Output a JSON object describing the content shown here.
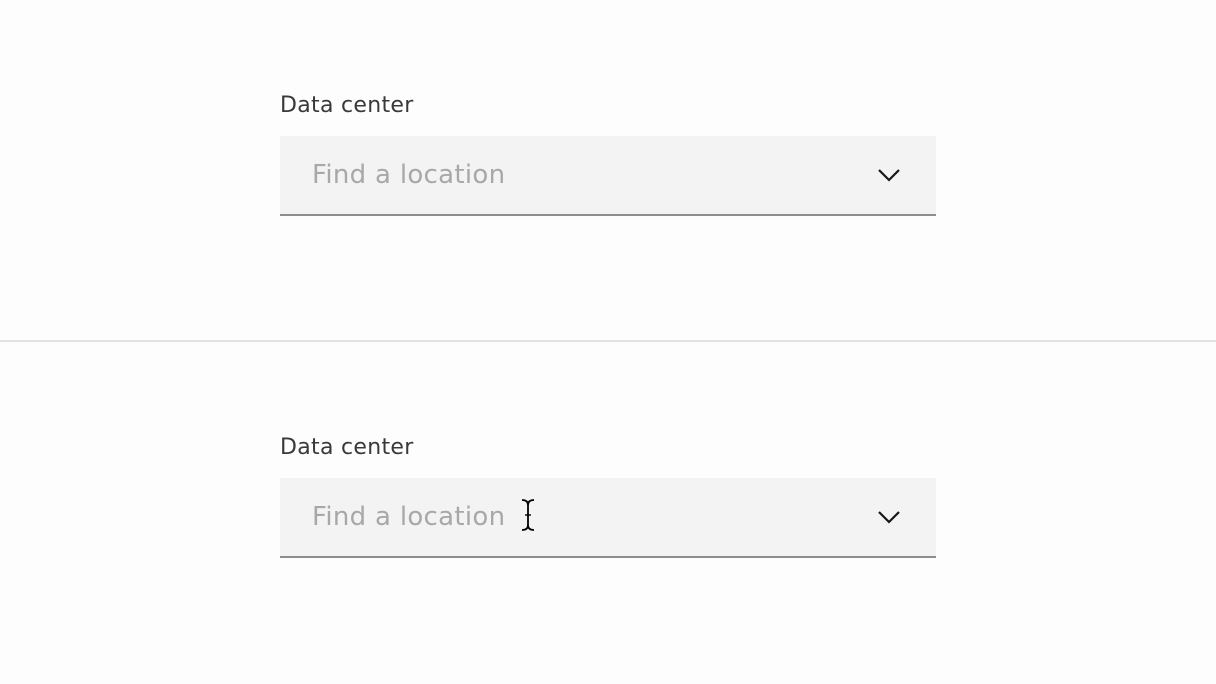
{
  "top_example": {
    "label": "Data center",
    "input": {
      "value": "",
      "placeholder": "Find a location"
    },
    "toggle_icon": "chevron-down-icon"
  },
  "bottom_example": {
    "label": "Data center",
    "input": {
      "value": "",
      "placeholder": "Find a location"
    },
    "toggle_icon": "chevron-down-icon",
    "cursor": "text-cursor-icon"
  },
  "colors": {
    "field_background": "#f3f3f3",
    "field_border": "#8d8d8d",
    "placeholder": "#a8a8a8",
    "label": "#393939",
    "divider": "#e2e2e2",
    "page_background": "#fdfdfd"
  }
}
